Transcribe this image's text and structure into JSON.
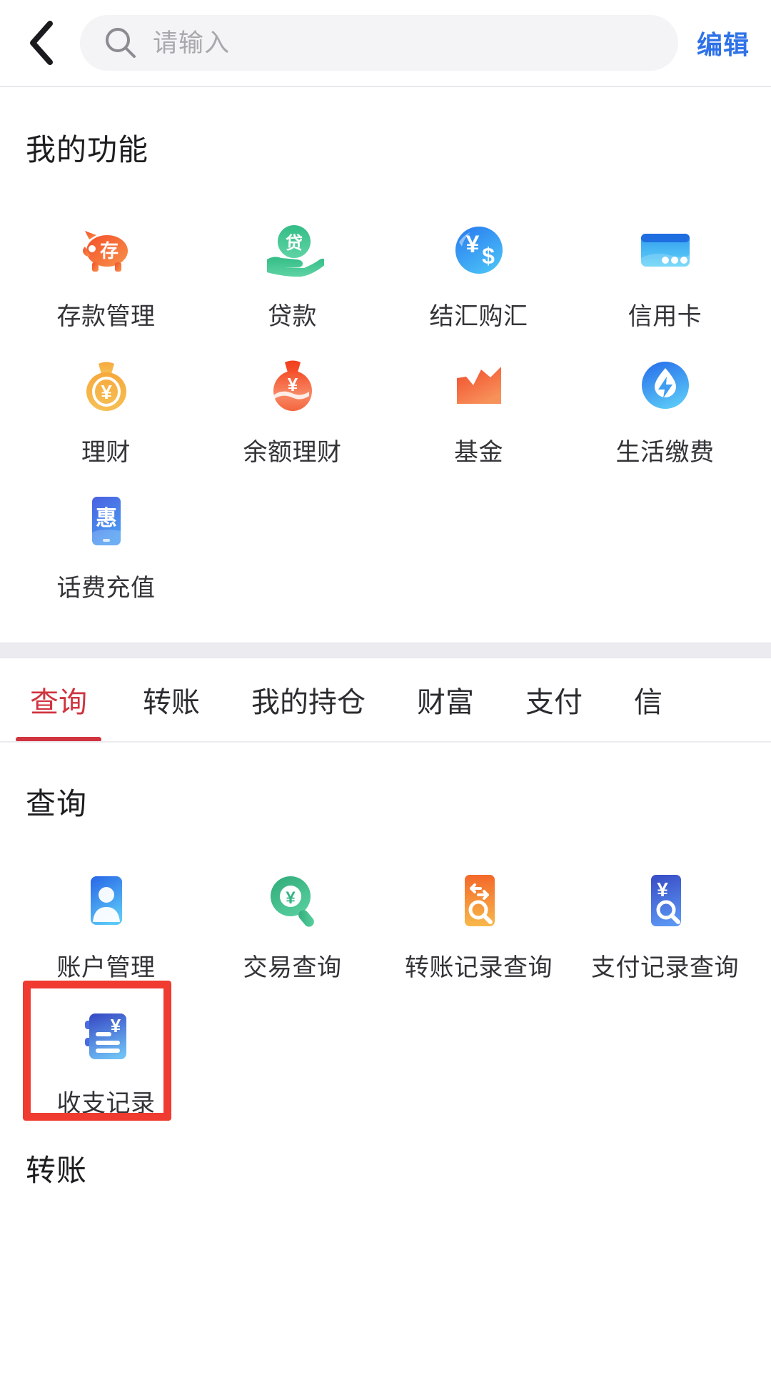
{
  "header": {
    "back_icon": "chevron-left-icon",
    "search": {
      "icon": "search-icon",
      "placeholder": "请输入",
      "value": ""
    },
    "edit_label": "编辑",
    "edit_color": "#2f72e8"
  },
  "my_functions": {
    "title": "我的功能",
    "items": [
      {
        "label": "存款管理",
        "icon": "piggy-bank-icon",
        "glyph": "存",
        "color": "#f46b36"
      },
      {
        "label": "贷款",
        "icon": "hand-coin-icon",
        "glyph": "贷",
        "color": "#3cb887"
      },
      {
        "label": "结汇购汇",
        "icon": "currency-exchange-icon",
        "glyph": "¥$",
        "color": "#2f9cf4"
      },
      {
        "label": "信用卡",
        "icon": "credit-card-icon",
        "glyph": "",
        "color": "#2f86f0"
      },
      {
        "label": "理财",
        "icon": "money-bag-yuan-icon",
        "glyph": "¥",
        "color": "#f2a33c"
      },
      {
        "label": "余额理财",
        "icon": "money-bag-red-icon",
        "glyph": "¥",
        "color": "#f2543c"
      },
      {
        "label": "基金",
        "icon": "growth-chart-icon",
        "glyph": "",
        "color": "#f4603c"
      },
      {
        "label": "生活缴费",
        "icon": "utility-payment-icon",
        "glyph": "",
        "color": "#2f7ae8"
      },
      {
        "label": "话费充值",
        "icon": "phone-recharge-icon",
        "glyph": "惠",
        "color": "#4a7ef0"
      }
    ]
  },
  "tabs": {
    "active_color": "#d0343f",
    "items": [
      {
        "label": "查询",
        "active": true
      },
      {
        "label": "转账",
        "active": false
      },
      {
        "label": "我的持仓",
        "active": false
      },
      {
        "label": "财富",
        "active": false
      },
      {
        "label": "支付",
        "active": false
      },
      {
        "label": "信",
        "active": false
      }
    ]
  },
  "query_section": {
    "title": "查询",
    "items": [
      {
        "label": "账户管理",
        "icon": "account-card-icon",
        "glyph": "",
        "color": "#2f86f0"
      },
      {
        "label": "交易查询",
        "icon": "magnifier-yuan-green-icon",
        "glyph": "¥",
        "color": "#3cb887"
      },
      {
        "label": "转账记录查询",
        "icon": "transfer-search-icon",
        "glyph": "",
        "color": "#f4923c"
      },
      {
        "label": "支付记录查询",
        "icon": "payment-search-icon",
        "glyph": "¥",
        "color": "#3f5fd0"
      },
      {
        "label": "收支记录",
        "icon": "ledger-book-icon",
        "glyph": "¥",
        "color": "#3f5fd0",
        "highlighted": true
      }
    ]
  },
  "transfer_section": {
    "title": "转账"
  },
  "annotation": {
    "box_color": "#ef3b30",
    "target_label": "收支记录"
  }
}
